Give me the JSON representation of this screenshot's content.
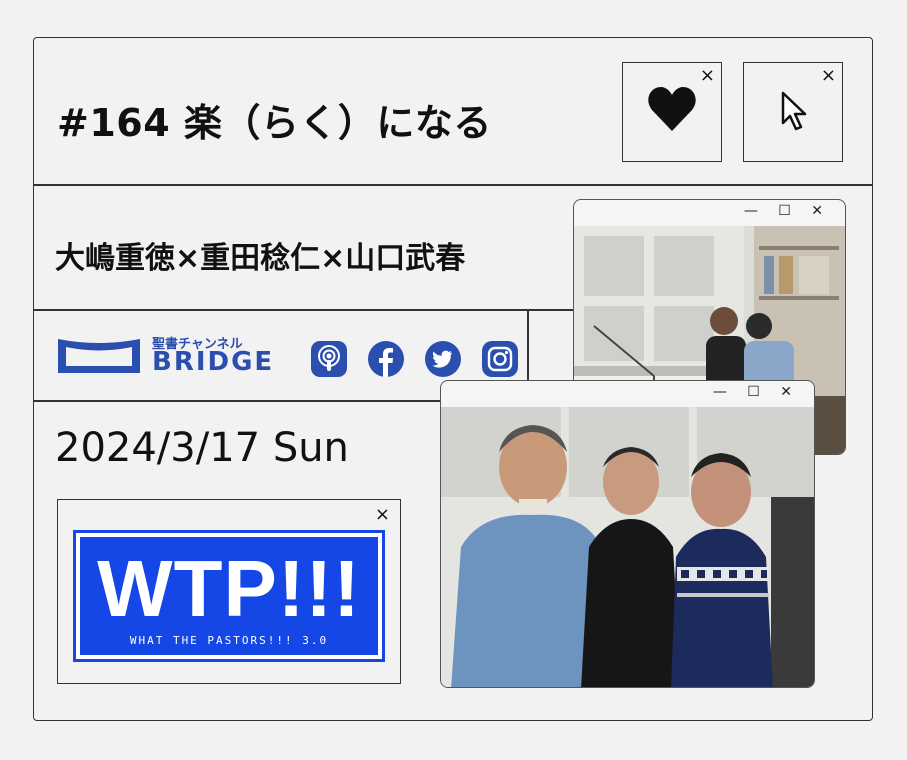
{
  "header": {
    "title": "#164 楽（らく）になる",
    "like_close": "×",
    "cursor_close": "×"
  },
  "guests": "大嶋重徳×重田稔仁×山口武春",
  "channel": {
    "subtitle": "聖書チャンネル",
    "name": "BRIDGE",
    "brand_color": "#2a4fae"
  },
  "social": [
    "podcast-icon",
    "facebook-icon",
    "twitter-icon",
    "instagram-icon"
  ],
  "date": "2024/3/17 Sun",
  "show": {
    "logo_text": "WTP!!!",
    "logo_subtitle": "WHAT THE PASTORS!!! 3.0",
    "logo_color": "#1447e6",
    "close": "×"
  },
  "window_controls": "— ☐ ✕"
}
